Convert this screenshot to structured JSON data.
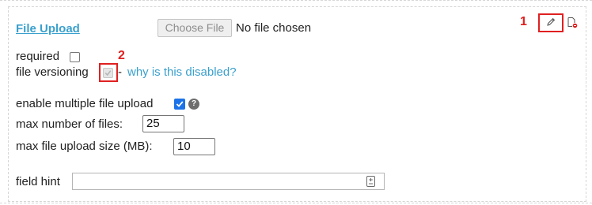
{
  "field": {
    "title": "File Upload",
    "choose_button": "Choose File",
    "no_file_text": "No file chosen"
  },
  "options": {
    "required_label": "required",
    "versioning_label": "file versioning",
    "separator": "-",
    "versioning_link": "why is this disabled?",
    "multiple_label": "enable multiple file upload",
    "help_glyph": "?",
    "max_files_label": "max number of files:",
    "max_files_value": "25",
    "max_size_label": "max file upload size (MB):",
    "max_size_value": "10",
    "hint_label": "field hint",
    "hint_value": ""
  },
  "annotations": {
    "marker_1": "1",
    "marker_2": "2",
    "color": "#e02020"
  },
  "icons": {
    "edit": "pencil-icon",
    "delete": "file-delete-icon",
    "hint_picker": "form-picker-icon",
    "help": "help-circle-icon"
  },
  "colors": {
    "accent": "#3aa0cd",
    "checkbox_checked": "#1a73e8"
  }
}
